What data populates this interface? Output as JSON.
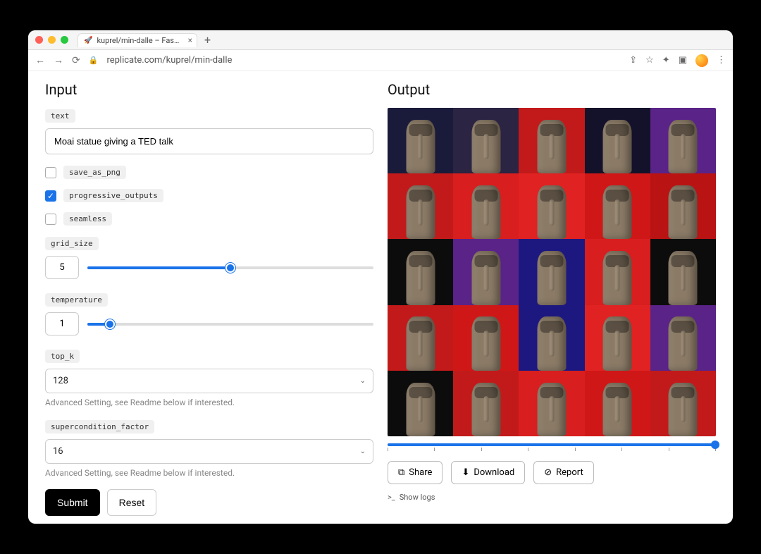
{
  "browser": {
    "tab_title": "kuprel/min-dalle – Fast, minim…",
    "url": "replicate.com/kuprel/min-dalle"
  },
  "input": {
    "heading": "Input",
    "text": {
      "label": "text",
      "value": "Moai statue giving a TED talk"
    },
    "save_as_png": {
      "label": "save_as_png",
      "checked": false
    },
    "progressive_outputs": {
      "label": "progressive_outputs",
      "checked": true
    },
    "seamless": {
      "label": "seamless",
      "checked": false
    },
    "grid_size": {
      "label": "grid_size",
      "value": "5",
      "fill_pct": 50
    },
    "temperature": {
      "label": "temperature",
      "value": "1",
      "fill_pct": 8
    },
    "top_k": {
      "label": "top_k",
      "value": "128",
      "helper": "Advanced Setting, see Readme below if interested."
    },
    "supercondition_factor": {
      "label": "supercondition_factor",
      "value": "16",
      "helper": "Advanced Setting, see Readme below if interested."
    },
    "submit": "Submit",
    "reset": "Reset"
  },
  "output": {
    "heading": "Output",
    "share": "Share",
    "download": "Download",
    "report": "Report",
    "show_logs": "Show logs",
    "grid_bg": [
      "#1a1a3a",
      "#2b2442",
      "#c21a1a",
      "#14122a",
      "#5a2388",
      "#c21a1a",
      "#d81e1e",
      "#e02222",
      "#cf1717",
      "#b91313",
      "#0c0c0c",
      "#5a2388",
      "#1d1880",
      "#d81e1e",
      "#0c0c0c",
      "#c21a1a",
      "#cf1717",
      "#1d1880",
      "#e02222",
      "#5a2388",
      "#0c0c0c",
      "#c21a1a",
      "#d81e1e",
      "#cf1717",
      "#c21a1a"
    ]
  }
}
